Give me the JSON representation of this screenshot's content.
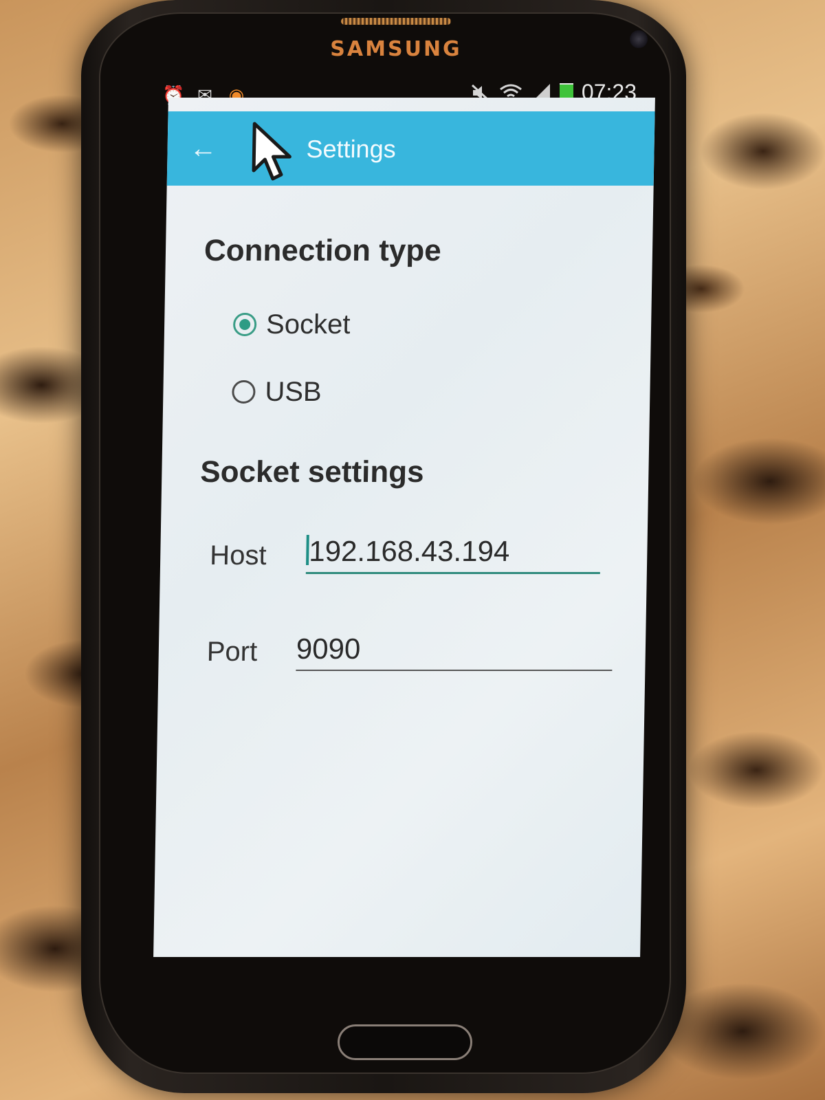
{
  "device": {
    "brand": "SAMSUNG"
  },
  "status_bar": {
    "left_icons": [
      "alarm-icon",
      "mail-icon",
      "app-notification-icon"
    ],
    "right_icons": [
      "mute-icon",
      "wifi-icon",
      "signal-icon",
      "battery-icon"
    ],
    "battery_level": 0.9,
    "time": "07:23"
  },
  "action_bar": {
    "title": "Settings",
    "accent_color": "#38b6dd"
  },
  "connection": {
    "heading": "Connection type",
    "options": [
      {
        "label": "Socket",
        "selected": true
      },
      {
        "label": "USB",
        "selected": false
      }
    ],
    "accent_color": "#2e9c84"
  },
  "socket_settings": {
    "heading": "Socket settings",
    "host": {
      "label": "Host",
      "value": "192.168.43.194"
    },
    "port": {
      "label": "Port",
      "value": "9090"
    }
  }
}
